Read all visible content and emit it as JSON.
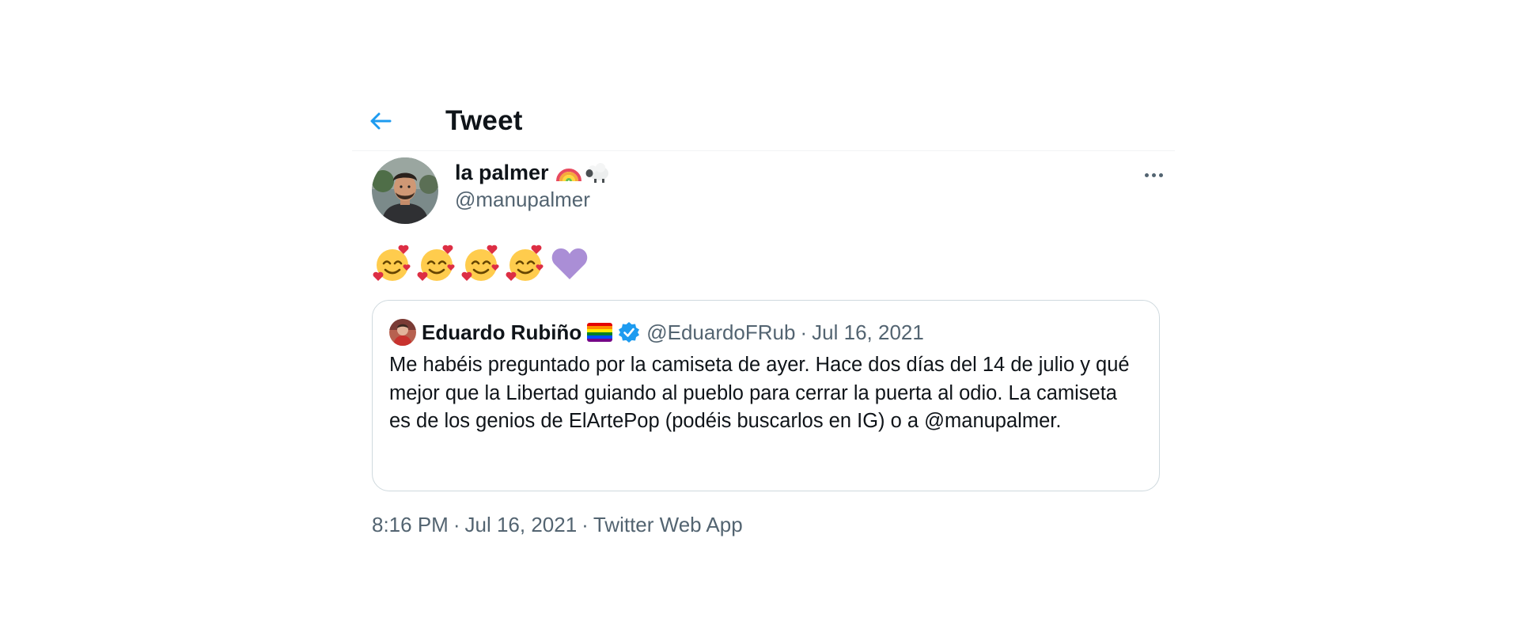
{
  "header": {
    "title": "Tweet",
    "back_icon": "arrow-left-icon",
    "accent_color": "#1d9bf0"
  },
  "author": {
    "display_name": "la palmer",
    "name_emojis": [
      "rainbow",
      "sheep"
    ],
    "handle": "@manupalmer",
    "more_icon": "more-horizontal-icon"
  },
  "tweet": {
    "emoji_text": "🥰🥰🥰🥰💜",
    "emojis": [
      "smiling-face-with-hearts",
      "smiling-face-with-hearts",
      "smiling-face-with-hearts",
      "smiling-face-with-hearts",
      "purple-heart"
    ]
  },
  "quote": {
    "display_name": "Eduardo Rubiño",
    "flag_icon": "rainbow-flag-icon",
    "verified_icon": "verified-badge-icon",
    "handle": "@EduardoFRub",
    "separator": "·",
    "date": "Jul 16, 2021",
    "body": "Me habéis preguntado por la camiseta de ayer. Hace dos días del 14 de julio y qué mejor que la Libertad guiando al pueblo para cerrar la puerta al odio. La camiseta es de los genios de ElArtePop (podéis buscarlos en IG) o a @manupalmer."
  },
  "meta": {
    "time": "8:16 PM",
    "date": "Jul 16, 2021",
    "source": "Twitter Web App",
    "separator": "·"
  }
}
